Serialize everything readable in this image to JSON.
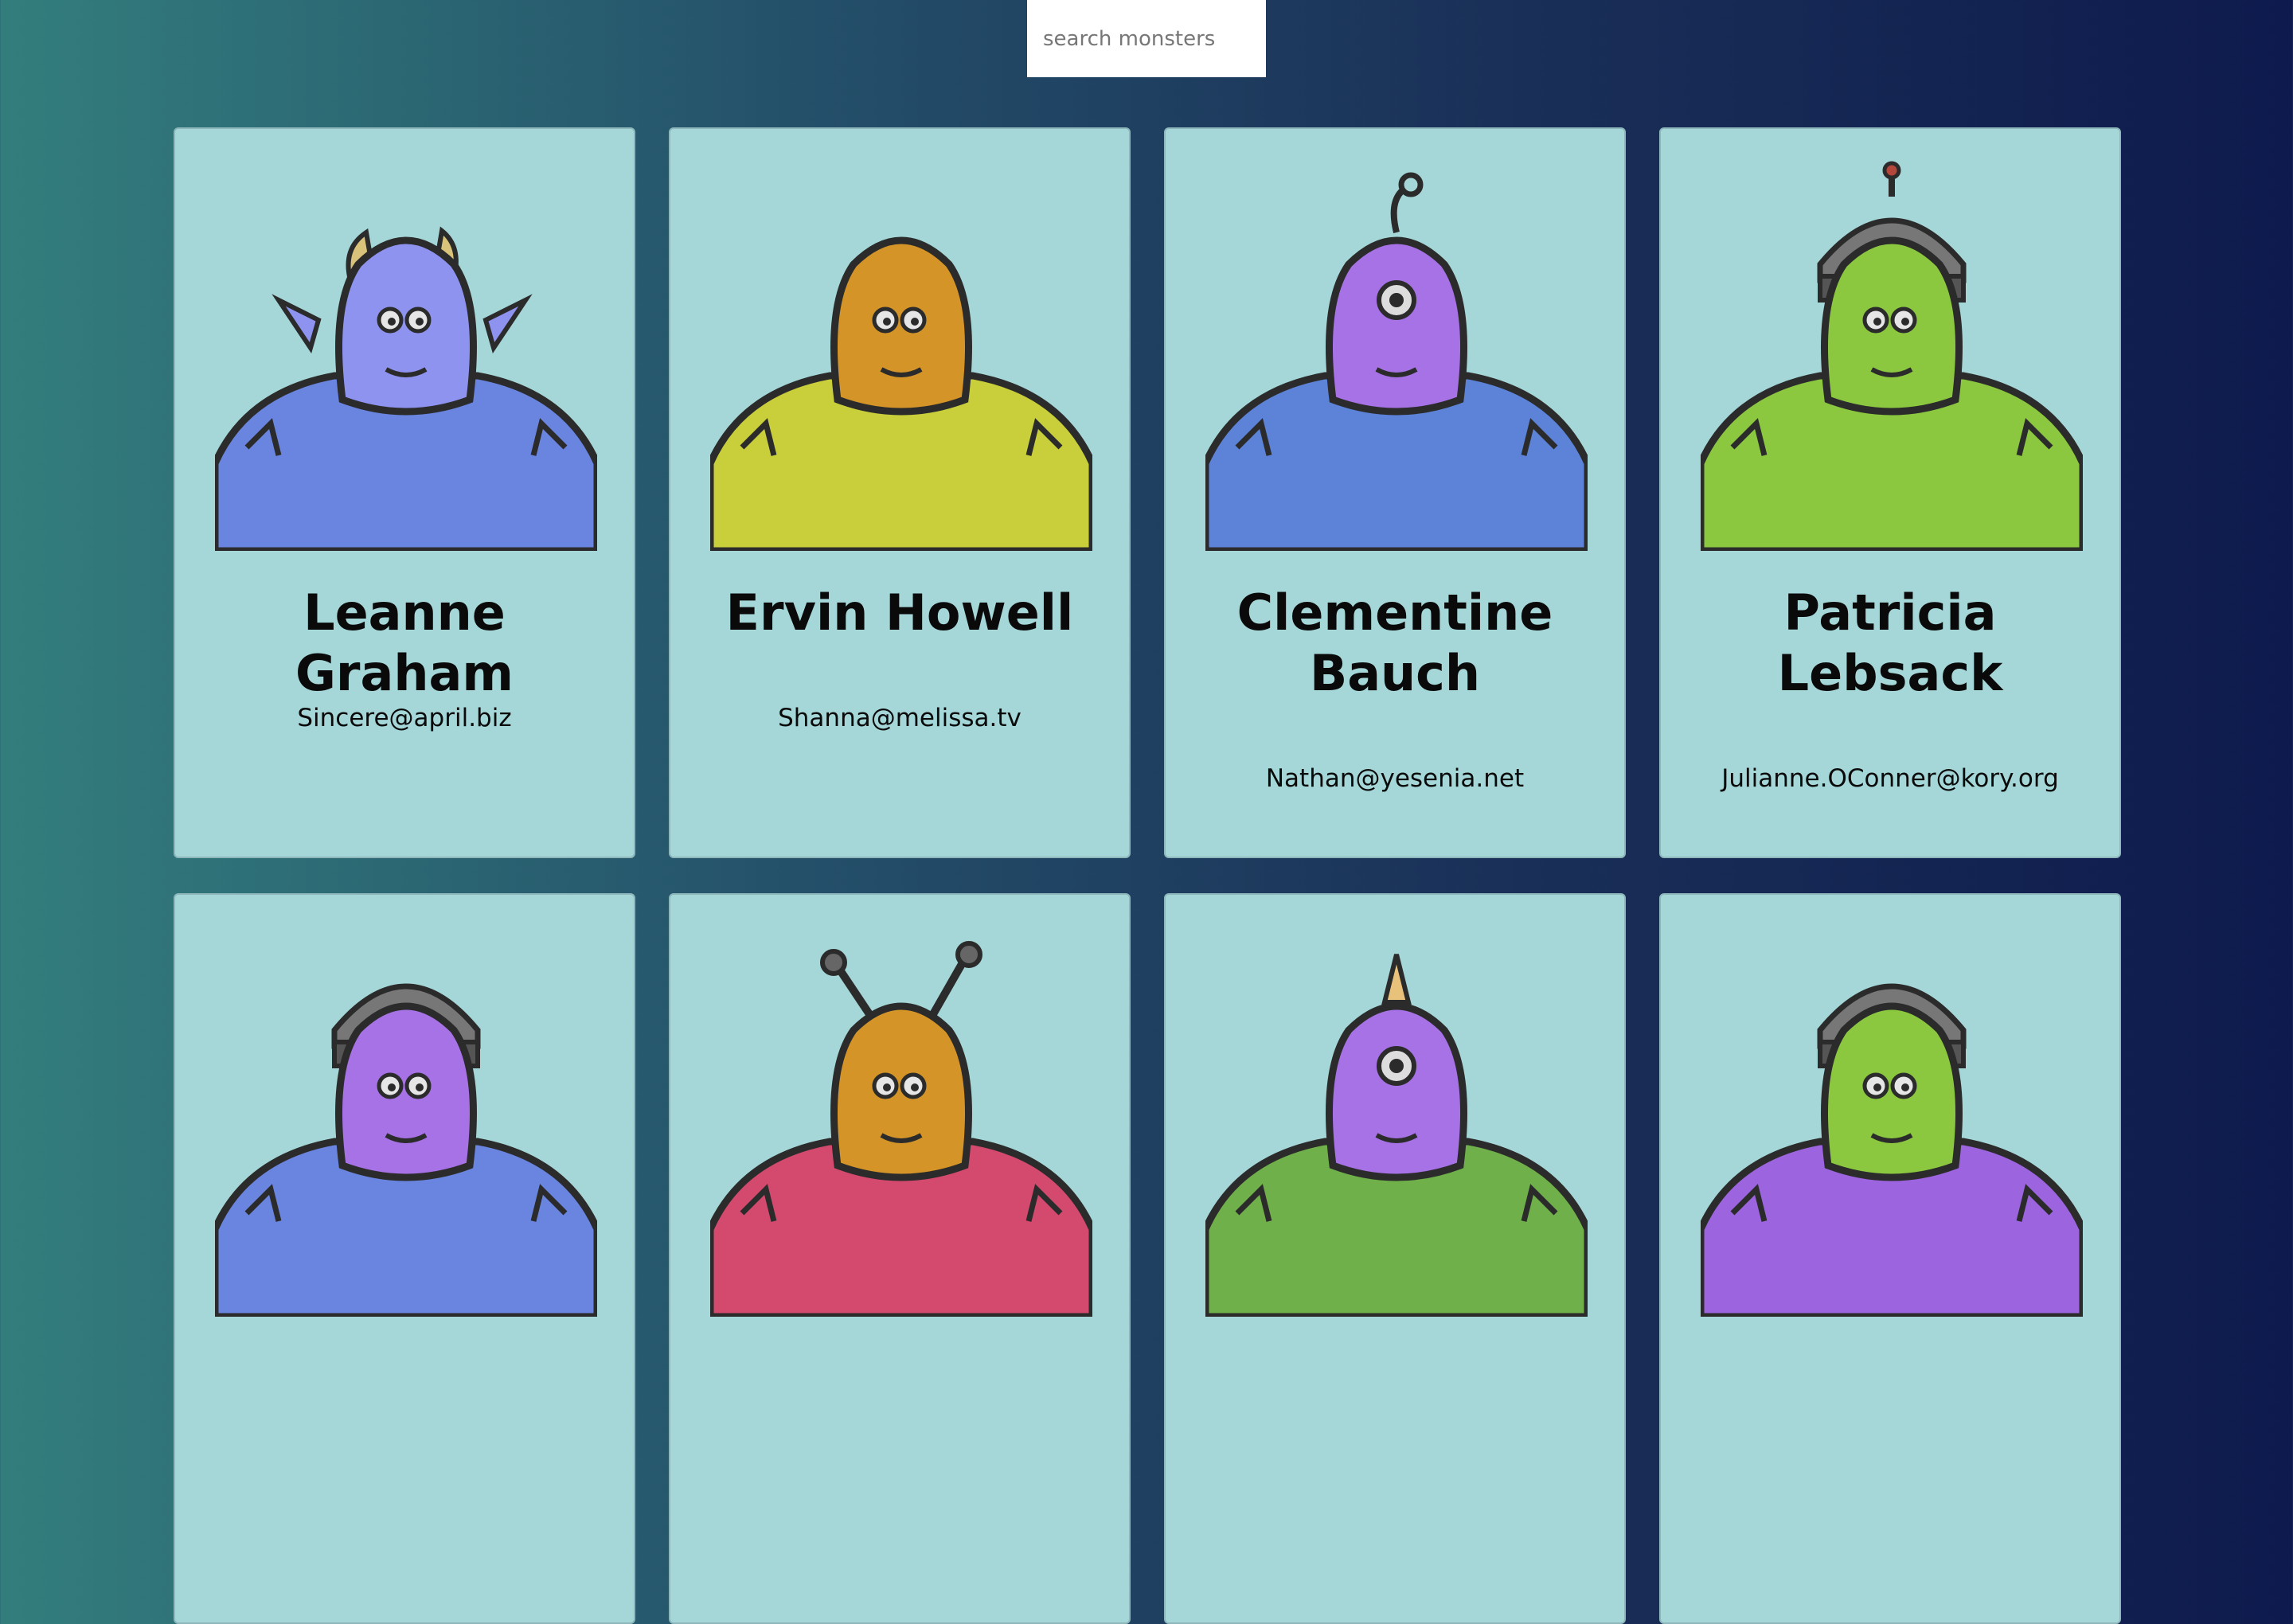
{
  "search": {
    "placeholder": "search monsters"
  },
  "monsters": [
    {
      "name": "Leanne Graham",
      "email": "Sincere@april.biz",
      "skin": "#8f93f0",
      "body": "#6a85e0",
      "head_shape": "horns"
    },
    {
      "name": "Ervin Howell",
      "email": "Shanna@melissa.tv",
      "skin": "#d49428",
      "body": "#c9cf3a",
      "head_shape": "hood"
    },
    {
      "name": "Clementine Bauch",
      "email": "Nathan@yesenia.net",
      "skin": "#a672e6",
      "body": "#5c83d8",
      "head_shape": "cyclops-antenna"
    },
    {
      "name": "Patricia Lebsack",
      "email": "Julianne.OConner@kory.org",
      "skin": "#8bc840",
      "body": "#8bc840",
      "head_shape": "helmet-robot"
    },
    {
      "name": "",
      "email": "",
      "skin": "#a672e6",
      "body": "#6a85e0",
      "head_shape": "helmet"
    },
    {
      "name": "",
      "email": "",
      "skin": "#d49428",
      "body": "#d44a6e",
      "head_shape": "antennae"
    },
    {
      "name": "",
      "email": "",
      "skin": "#a672e6",
      "body": "#6fb04a",
      "head_shape": "horn"
    },
    {
      "name": "",
      "email": "",
      "skin": "#8bc840",
      "body": "#9c64de",
      "head_shape": "helmet"
    }
  ]
}
